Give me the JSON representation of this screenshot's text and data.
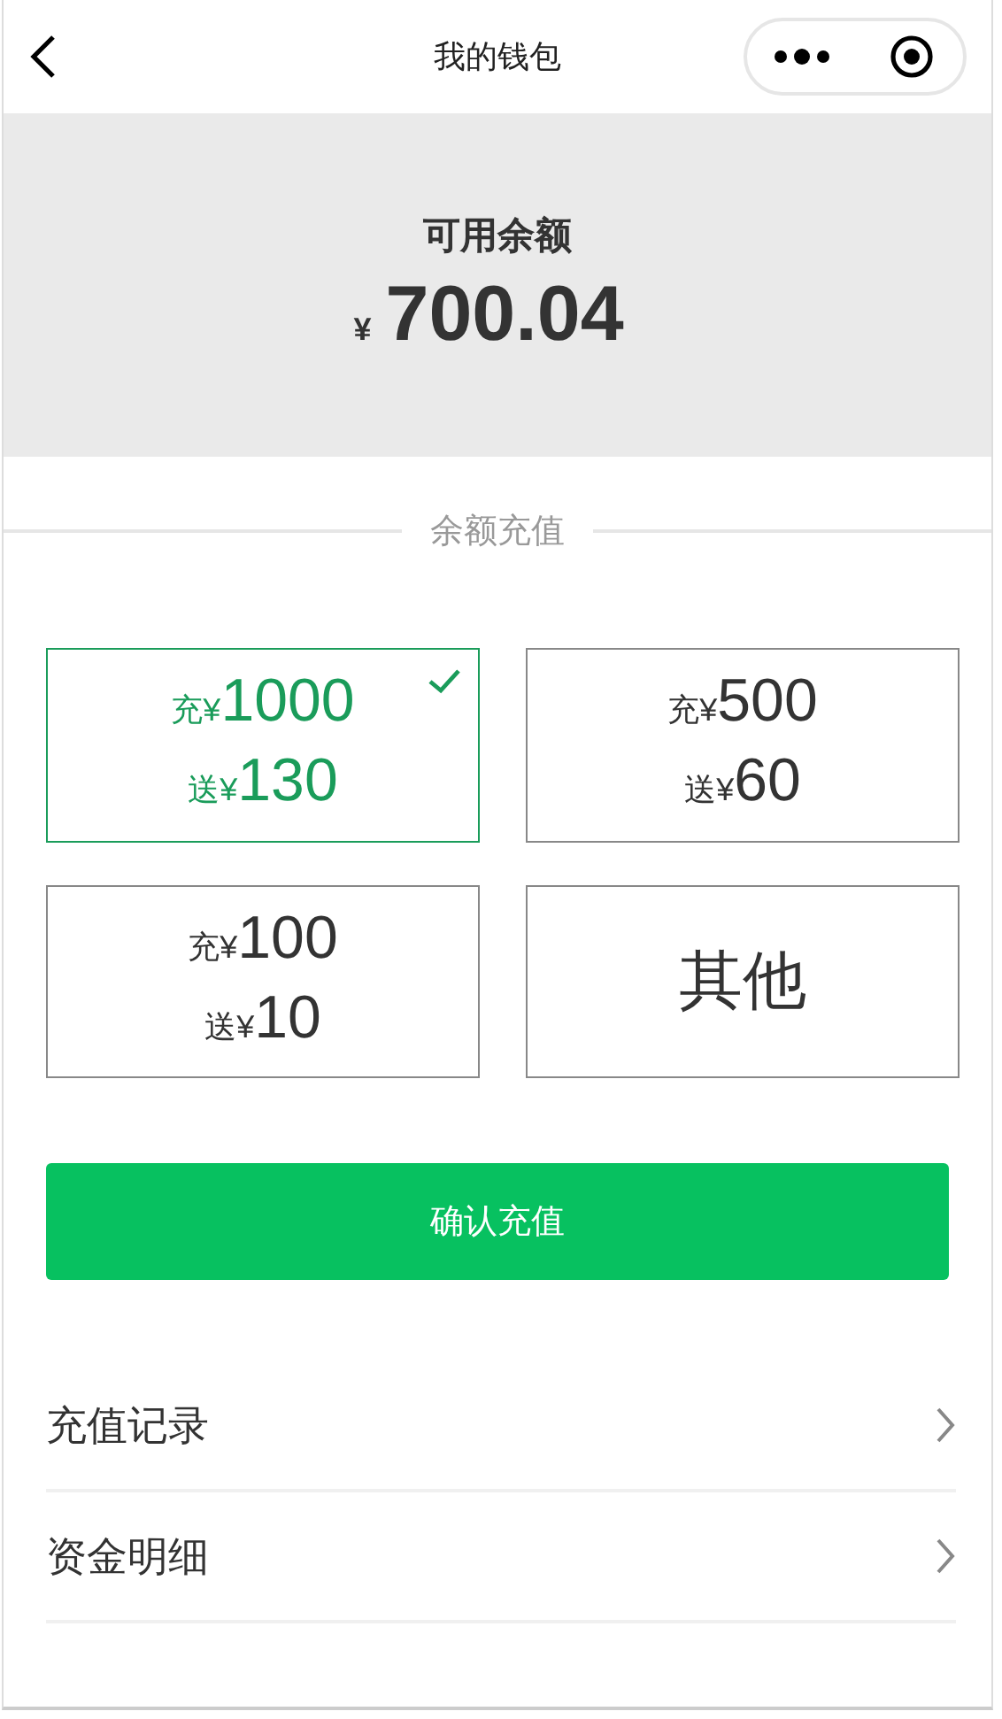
{
  "nav": {
    "title": "我的钱包"
  },
  "balance": {
    "label": "可用余额",
    "currency": "¥",
    "amount": "700.04"
  },
  "recharge": {
    "heading": "余额充值",
    "options": [
      {
        "kind": "amount",
        "charge_prefix": "充¥",
        "charge": "1000",
        "bonus_prefix": "送¥",
        "bonus": "130",
        "selected": true
      },
      {
        "kind": "amount",
        "charge_prefix": "充¥",
        "charge": "500",
        "bonus_prefix": "送¥",
        "bonus": "60",
        "selected": false
      },
      {
        "kind": "amount",
        "charge_prefix": "充¥",
        "charge": "100",
        "bonus_prefix": "送¥",
        "bonus": "10",
        "selected": false
      },
      {
        "kind": "other",
        "label": "其他",
        "selected": false
      }
    ],
    "button": "确认充值"
  },
  "links": [
    {
      "label": "充值记录"
    },
    {
      "label": "资金明细"
    }
  ]
}
